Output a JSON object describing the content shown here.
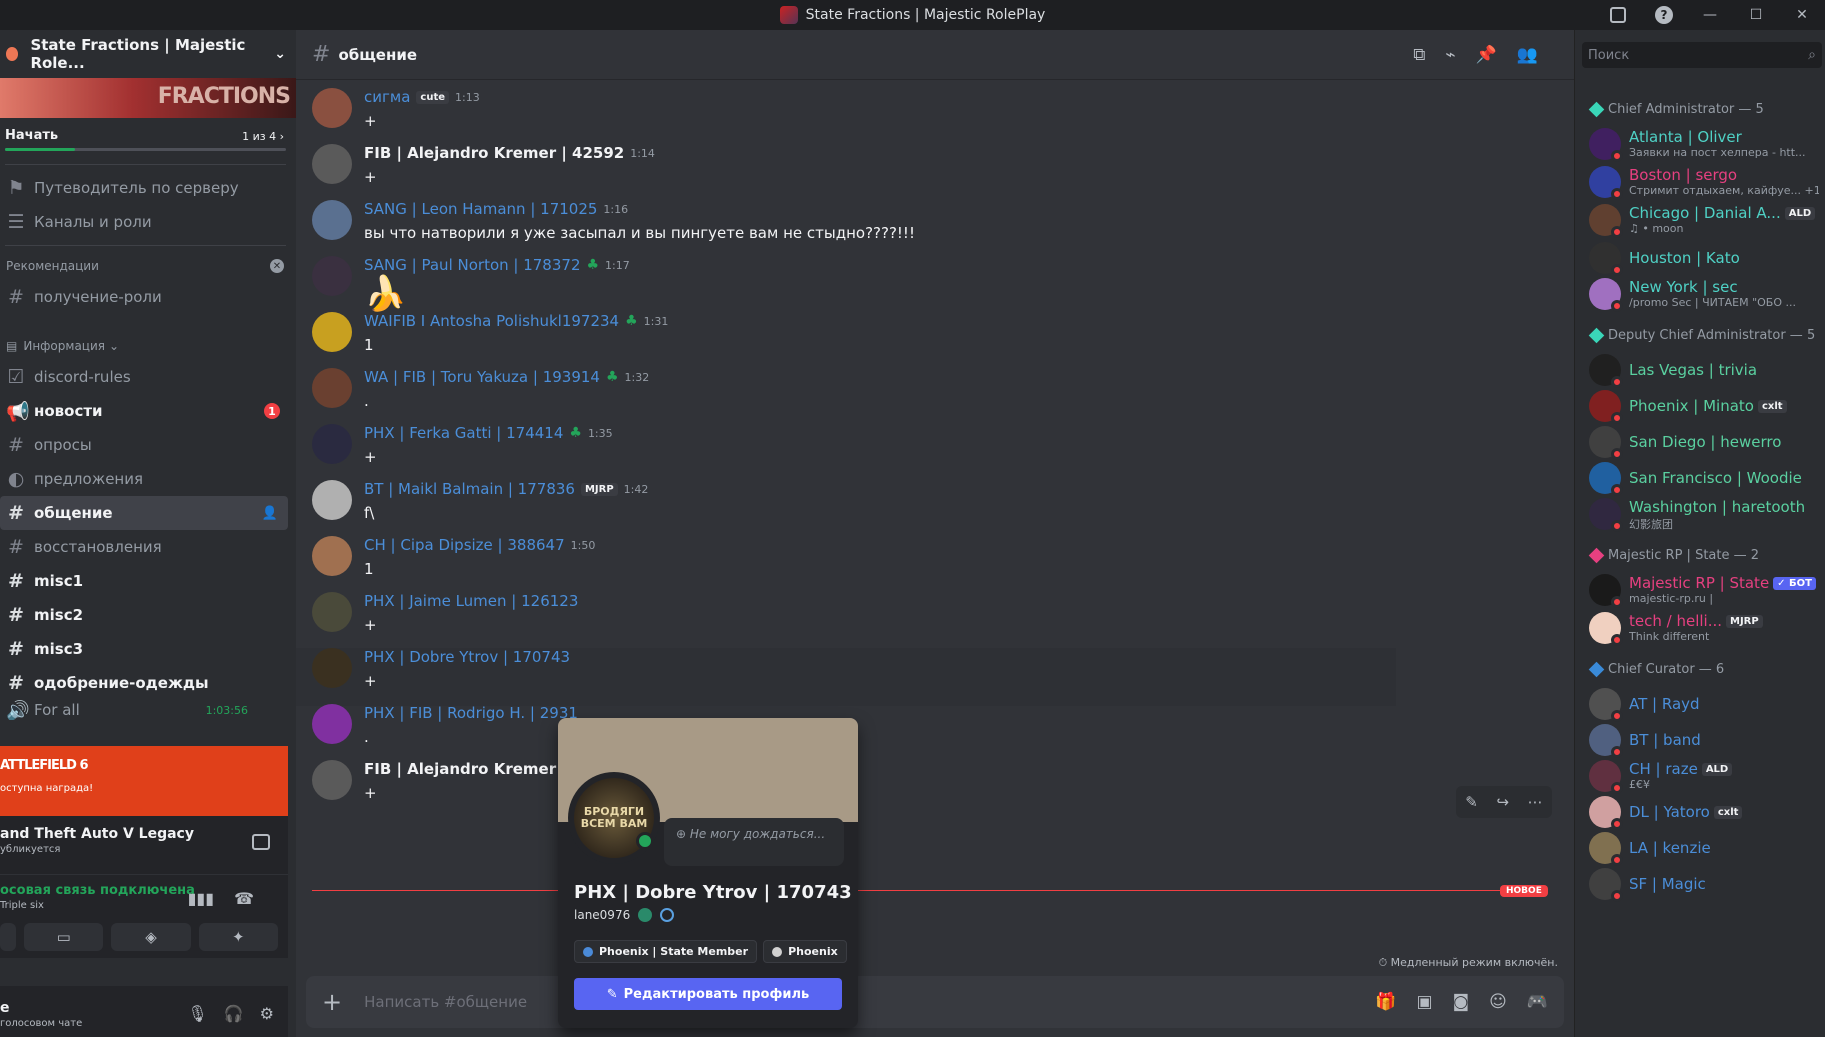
{
  "window": {
    "title": "State Fractions | Majestic RolePlay"
  },
  "sidebar": {
    "server_name": "State Fractions | Majestic Role...",
    "banner_text": "FRACTIONS",
    "start_label": "Начать",
    "start_progress": "1 из 4",
    "start_progress_fraction": 0.25,
    "guide": "Путеводитель по серверу",
    "channels_roles": "Каналы и роли",
    "recommendations": "Рекомендации",
    "get_role": "получение-роли",
    "info_category": "Информация",
    "channels": [
      {
        "name": "discord-rules",
        "bold": false
      },
      {
        "name": "новости",
        "bold": true,
        "badge": "1"
      },
      {
        "name": "опросы",
        "bold": false
      },
      {
        "name": "предложения",
        "bold": false
      },
      {
        "name": "общение",
        "selected": true
      },
      {
        "name": "восстановления",
        "bold": false
      },
      {
        "name": "misc1",
        "bold": true
      },
      {
        "name": "misc2",
        "bold": true
      },
      {
        "name": "misc3",
        "bold": true
      },
      {
        "name": "одобрение-одежды",
        "bold": true
      },
      {
        "name": "For all",
        "bold": false,
        "time": "1:03:56"
      }
    ],
    "promo_title": "ATTLEFIELD 6",
    "promo_sub": "оступна награда!",
    "activity_title": "and Theft Auto V Legacy",
    "activity_sub": "убликуется",
    "voice_status": "осовая связь подключена",
    "voice_channel": "Triple six",
    "user_name": "e",
    "user_status": "голосовом чате"
  },
  "channel": {
    "name": "общение"
  },
  "messages": [
    {
      "name": "сигма",
      "tag": "cute",
      "time": "1:13",
      "text": "+",
      "white": false
    },
    {
      "name": "FIB | Alejandro Kremer | 42592",
      "time": "1:14",
      "text": "+",
      "white": true
    },
    {
      "name": "SANG | Leon Hamann | 171025",
      "time": "1:16",
      "text": "вы что натворили я уже засыпал и вы пингуете вам не стыдно????!!!",
      "white": false
    },
    {
      "name": "SANG | Paul Norton | 178372",
      "time": "1:17",
      "text": "🍌",
      "white": false,
      "clover": true
    },
    {
      "name": "WAIFIB I Antosha Polishukl197234",
      "time": "1:31",
      "text": "1",
      "white": false,
      "clover": true
    },
    {
      "name": "WA | FIB | Toru Yakuza | 193914",
      "time": "1:32",
      "text": ".",
      "white": false,
      "clover": true
    },
    {
      "name": "PHX | Ferka Gatti | 174414",
      "time": "1:35",
      "text": "+",
      "white": false,
      "clover": true
    },
    {
      "name": "BT  | Maikl Balmain  | 177836",
      "tag": "MJRP",
      "time": "1:42",
      "text": "f\\",
      "white": false
    },
    {
      "name": "CH | Cipa Dipsize | 388647",
      "time": "1:50",
      "text": "1",
      "white": false
    },
    {
      "name": "PHX | Jaime Lumen | 126123",
      "time": "",
      "text": "+",
      "white": false
    },
    {
      "name": "PHX | Dobre Ytrov | 170743",
      "time": "",
      "text": "+",
      "white": false
    },
    {
      "name": "PHX | FIB | Rodrigo H. | 2931",
      "time": "",
      "text": ".",
      "white": false
    },
    {
      "name": "FIB | Alejandro Kremer | 425",
      "time": "",
      "text": "+",
      "white": true
    }
  ],
  "new_label": "НОВОЕ",
  "slow_mode": "Медленный режим включён.",
  "composer": {
    "placeholder": "Написать #общение"
  },
  "popout": {
    "note": "Не могу дождаться...",
    "display_name": "PHX | Dobre Ytrov | 170743",
    "username": "lane0976",
    "avatar_text": "БРОДЯГИ ВСЕМ ВАМ",
    "roles": [
      {
        "name": "Phoenix | State Member",
        "color": "#4a8ad8"
      },
      {
        "name": "Phoenix",
        "color": "#d0d0d0"
      }
    ],
    "edit_button": "Редактировать профиль"
  },
  "members": {
    "search_placeholder": "Поиск",
    "groups": [
      {
        "title": "Chief Administrator — 5",
        "color": "#3ad6b8",
        "items": [
          {
            "name": "Atlanta | Oliver",
            "sub": "Заявки на пост хелпера - htt...",
            "color": "#4fd1c5"
          },
          {
            "name": "Boston | sergo",
            "sub": "Стримит отдыхаем, кайфуе... +1",
            "color": "#e64080"
          },
          {
            "name": "Chicago | Danial A...",
            "tag": "ALD",
            "sub": "♫ • moon",
            "color": "#4fd1c5"
          },
          {
            "name": "Houston | Kato",
            "sub": "",
            "color": "#4fd1c5"
          },
          {
            "name": "New York | sec",
            "sub": "/promo Sec | ЧИТАЕМ \"ОБО ...",
            "color": "#4fd1c5"
          }
        ]
      },
      {
        "title": "Deputy Chief Administrator — 5",
        "color": "#3ad6b8",
        "items": [
          {
            "name": "Las Vegas | trivia",
            "sub": "",
            "color": "#5ad0a0"
          },
          {
            "name": "Phoenix | Minato",
            "tag": "cxlt",
            "sub": "",
            "color": "#5ad0a0"
          },
          {
            "name": "San Diego | hewerro",
            "sub": "",
            "color": "#5ad0a0"
          },
          {
            "name": "San Francisco | Woodie",
            "sub": "",
            "color": "#5ad0a0"
          },
          {
            "name": "Washington | haretooth",
            "sub": "幻影旅团",
            "color": "#5ad0a0"
          }
        ]
      },
      {
        "title": "Majestic RP | State — 2",
        "color": "#e64080",
        "items": [
          {
            "name": "Majestic RP | State",
            "tag": "✓ БОТ",
            "sub": "majestic-rp.ru |",
            "color": "#e64080"
          },
          {
            "name": "tech / helli...",
            "tag": "MJRP",
            "sub": "Think different",
            "color": "#e64080"
          }
        ]
      },
      {
        "title": "Chief Curator — 6",
        "color": "#3a8ad8",
        "items": [
          {
            "name": "AT | Rayd",
            "sub": "",
            "color": "#4b8ed8"
          },
          {
            "name": "BT | band",
            "sub": "",
            "color": "#4b8ed8"
          },
          {
            "name": "CH | raze",
            "tag": "ALD",
            "sub": "£€¥",
            "color": "#4b8ed8"
          },
          {
            "name": "DL | Yatoro",
            "tag": "cxlt",
            "sub": "",
            "color": "#4b8ed8"
          },
          {
            "name": "LA | kenzie",
            "sub": "",
            "color": "#4b8ed8"
          },
          {
            "name": "SF | Magic",
            "sub": "",
            "color": "#4b8ed8"
          }
        ]
      }
    ]
  }
}
